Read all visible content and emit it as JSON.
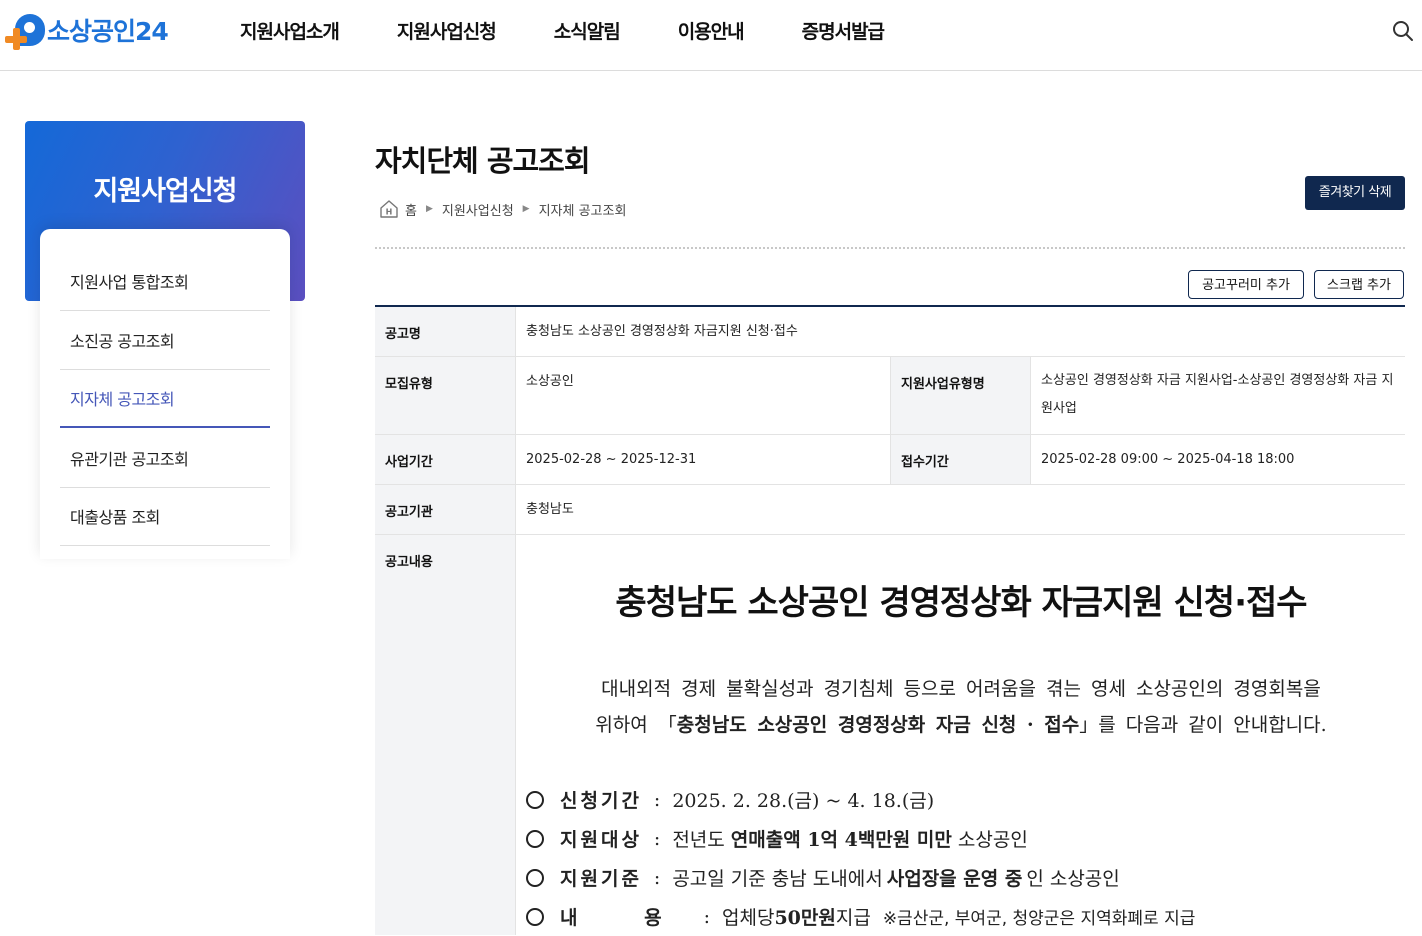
{
  "header": {
    "logo_text": "소상공인24",
    "nav": [
      "지원사업소개",
      "지원사업신청",
      "소식알림",
      "이용안내",
      "증명서발급"
    ],
    "search_icon": "search-icon"
  },
  "sidebar": {
    "title": "지원사업신청",
    "items": [
      {
        "label": "지원사업 통합조회"
      },
      {
        "label": "소진공 공고조회"
      },
      {
        "label": "지자체 공고조회"
      },
      {
        "label": "유관기관 공고조회"
      },
      {
        "label": "대출상품 조회"
      }
    ],
    "active_index": 2
  },
  "page": {
    "title": "자치단체 공고조회",
    "breadcrumb": [
      "홈",
      "지원사업신청",
      "지자체 공고조회"
    ],
    "favorite_button": "즐겨찾기 삭제",
    "bookmark_button": "공고꾸러미 추가",
    "scrap_button": "스크랩 추가"
  },
  "notice": {
    "name_label": "공고명",
    "name": "충청남도 소상공인 경영정상화 자금지원 신청·접수",
    "recruit_type_label": "모집유형",
    "recruit_type": "소상공인",
    "program_type_label": "지원사업유형명",
    "program_type": "소상공인 경영정상화 자금 지원사업-소상공인 경영정상화 자금 지원사업",
    "period_label": "사업기간",
    "period": "2025-02-28 ~ 2025-12-31",
    "apply_period_label": "접수기간",
    "apply_period": "2025-02-28 09:00 ~ 2025-04-18 18:00",
    "agency_label": "공고기관",
    "agency": "충청남도",
    "content_label": "공고내용"
  },
  "document": {
    "title": "충청남도 소상공인 경영정상화 자금지원 신청·접수",
    "intro_1": "대내외적 경제 불확실성과 경기침체 등으로 어려움을 겪는 영세 소상공인의 경영회복을",
    "intro_2_pre": "위하여 「",
    "intro_2_bold": "충청남도 소상공인 경영정상화 자금 신청 · 접수",
    "intro_2_post": "」를 다음과 같이 안내합니다.",
    "items": [
      {
        "label": "신청기간",
        "text": "2025. 2. 28.(금) ~ 4. 18.(금)"
      },
      {
        "label": "지원대상",
        "text_pre": "전년도 ",
        "text_bold": "연매출액 1억 4백만원 미만",
        "text_post": " 소상공인"
      },
      {
        "label": "지원기준",
        "text_pre": "공고일 기준 충남 도내에서 ",
        "text_bold": "사업장을 운영 중",
        "text_post": "인 소상공인"
      },
      {
        "label": "내 용",
        "text_pre": "업체당 ",
        "text_bold": "50만원",
        "text_post": " 지급",
        "note": "※금산군, 부여군, 청양군은 지역화폐로 지급"
      }
    ]
  }
}
